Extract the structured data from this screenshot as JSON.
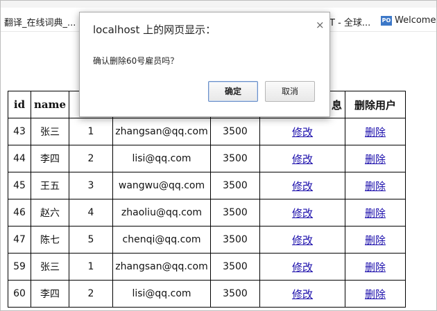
{
  "bookmarks": {
    "item1": "翻译_在线词典_...",
    "item2": "T - 全球...",
    "item3_icon": "PO",
    "item3": "Welcome"
  },
  "table": {
    "headers": [
      "id",
      "name",
      "",
      "",
      "",
      "息",
      "删除用户"
    ],
    "rows": [
      {
        "id": "43",
        "name": "张三",
        "num": "1",
        "email": "zhangsan@qq.com",
        "salary": "3500",
        "edit": "修改",
        "delete": "删除"
      },
      {
        "id": "44",
        "name": "李四",
        "num": "2",
        "email": "lisi@qq.com",
        "salary": "3500",
        "edit": "修改",
        "delete": "删除"
      },
      {
        "id": "45",
        "name": "王五",
        "num": "3",
        "email": "wangwu@qq.com",
        "salary": "3500",
        "edit": "修改",
        "delete": "删除"
      },
      {
        "id": "46",
        "name": "赵六",
        "num": "4",
        "email": "zhaoliu@qq.com",
        "salary": "3500",
        "edit": "修改",
        "delete": "删除"
      },
      {
        "id": "47",
        "name": "陈七",
        "num": "5",
        "email": "chenqi@qq.com",
        "salary": "3500",
        "edit": "修改",
        "delete": "删除"
      },
      {
        "id": "59",
        "name": "张三",
        "num": "1",
        "email": "zhangsan@qq.com",
        "salary": "3500",
        "edit": "修改",
        "delete": "删除"
      },
      {
        "id": "60",
        "name": "李四",
        "num": "2",
        "email": "lisi@qq.com",
        "salary": "3500",
        "edit": "修改",
        "delete": "删除"
      }
    ]
  },
  "dialog": {
    "title": "localhost 上的网页显示：",
    "close": "×",
    "message": "确认删除60号雇员吗？",
    "ok_label": "确定",
    "cancel_label": "取消"
  }
}
